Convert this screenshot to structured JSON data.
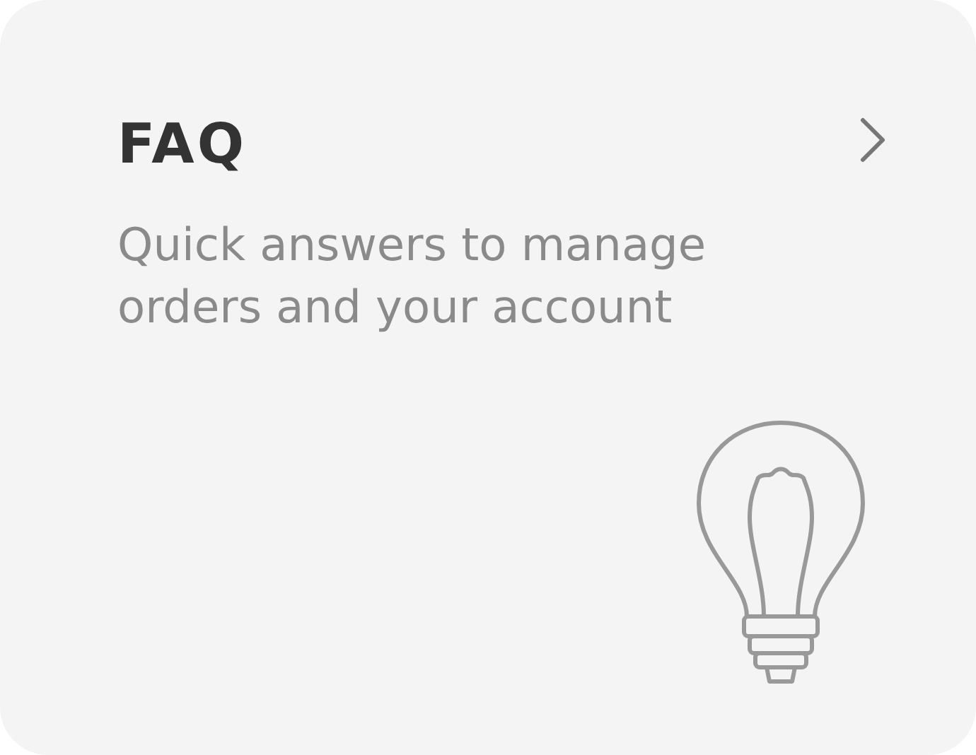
{
  "card": {
    "title": "FAQ",
    "description": "Quick answers to manage orders and your account"
  }
}
